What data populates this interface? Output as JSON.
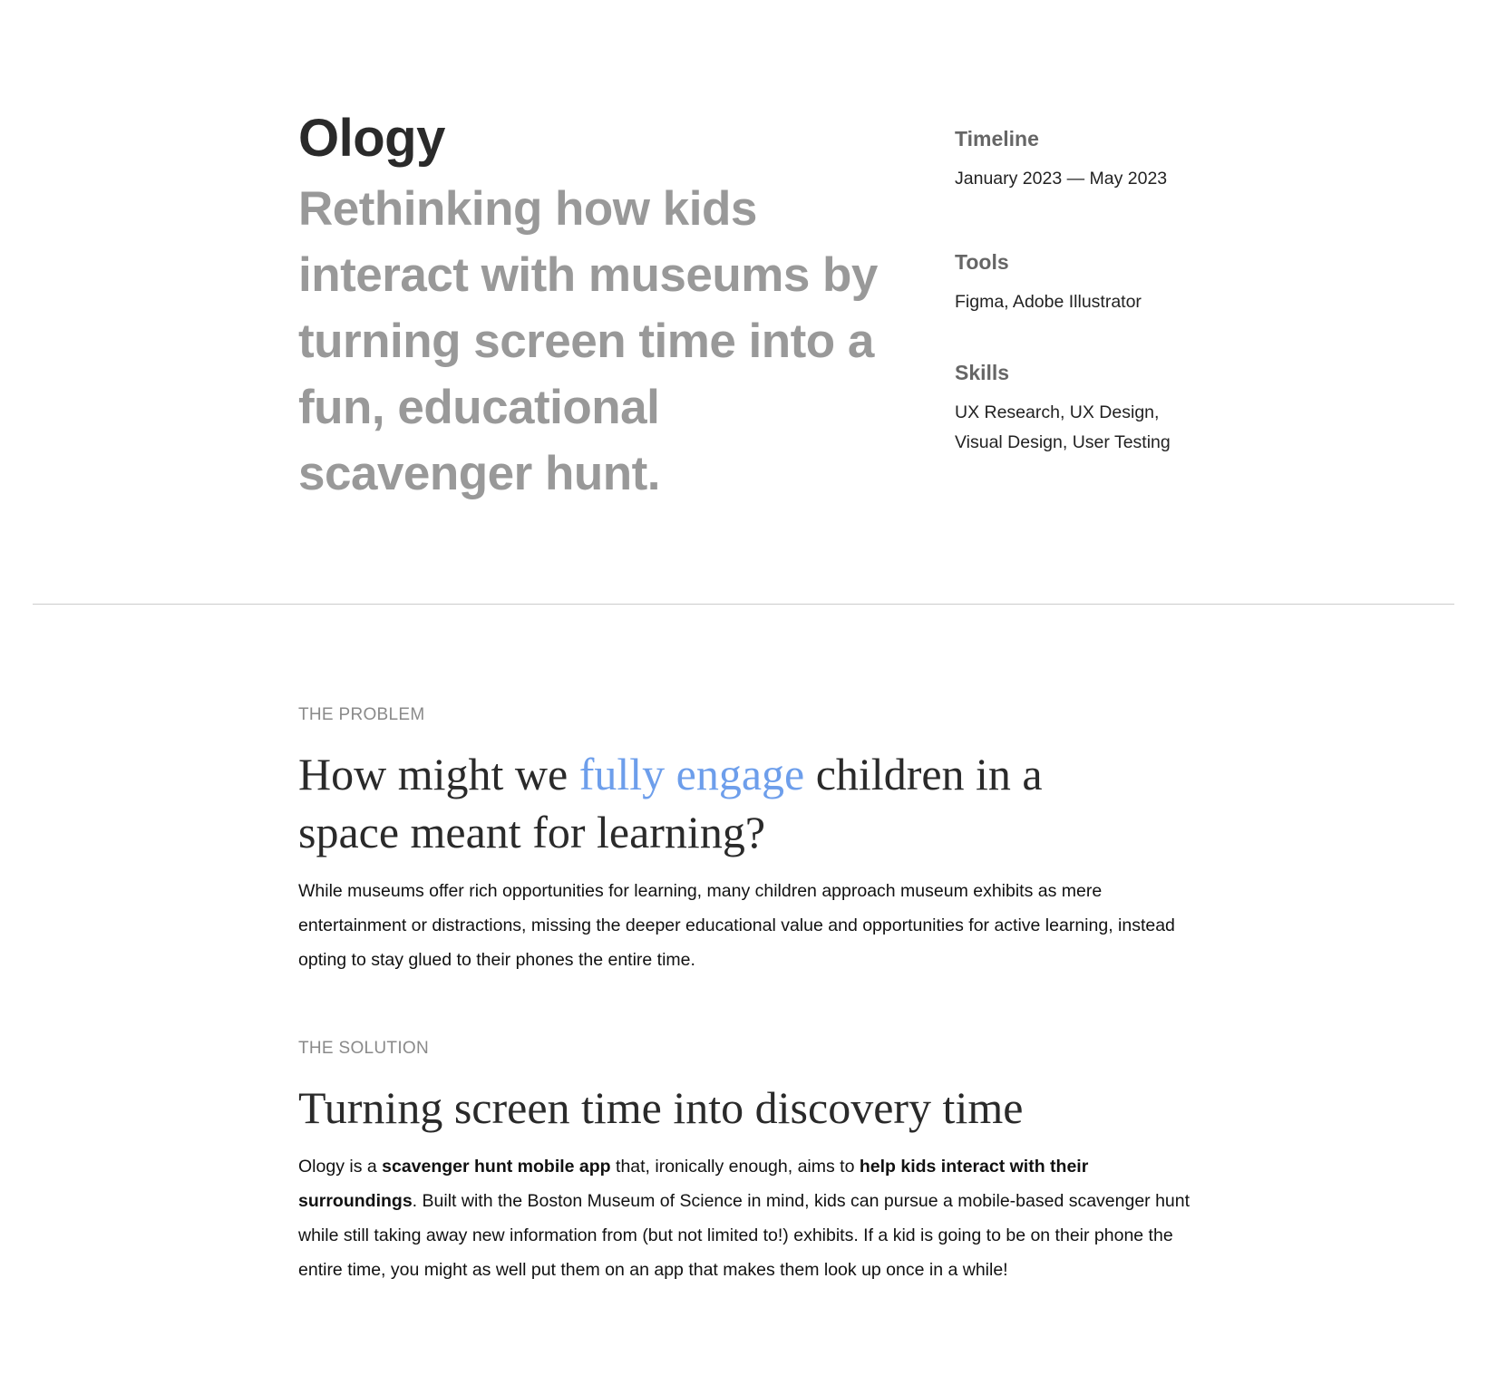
{
  "hero": {
    "title": "Ology",
    "tagline": "Rethinking how kids interact with museums by turning screen time into a fun, educational scavenger hunt."
  },
  "meta": {
    "timeline_label": "Timeline",
    "timeline_value": "January 2023 — May 2023",
    "tools_label": "Tools",
    "tools_value": "Figma, Adobe Illustrator",
    "skills_label": "Skills",
    "skills_line1": "UX Research, UX Design,",
    "skills_line2": "Visual Design, User Testing"
  },
  "problem": {
    "eyebrow": "THE PROBLEM",
    "heading_pre": "How might we ",
    "heading_accent": "fully engage",
    "heading_post": " children in a space meant for learning?",
    "body": "While museums offer rich opportunities for learning, many children approach museum exhibits as mere entertainment or distractions, missing the deeper educational value and opportunities for active learning, instead opting to stay glued to their phones the entire time."
  },
  "solution": {
    "eyebrow": "THE SOLUTION",
    "heading": "Turning screen time into discovery time",
    "body_1": "Ology is a ",
    "body_bold_1": "scavenger hunt mobile app",
    "body_2": " that, ironically enough, aims to ",
    "body_bold_2": "help kids interact with their surroundings",
    "body_3": ". Built with the Boston Museum of Science in mind, kids can pursue a mobile-based scavenger hunt while still taking away new information from (but not limited to!) exhibits. If a kid is going to be on their phone the entire time, you might as well put them on an app that makes them look up once in a while!"
  },
  "colors": {
    "accent": "#6d9eeb",
    "muted": "#999999"
  }
}
